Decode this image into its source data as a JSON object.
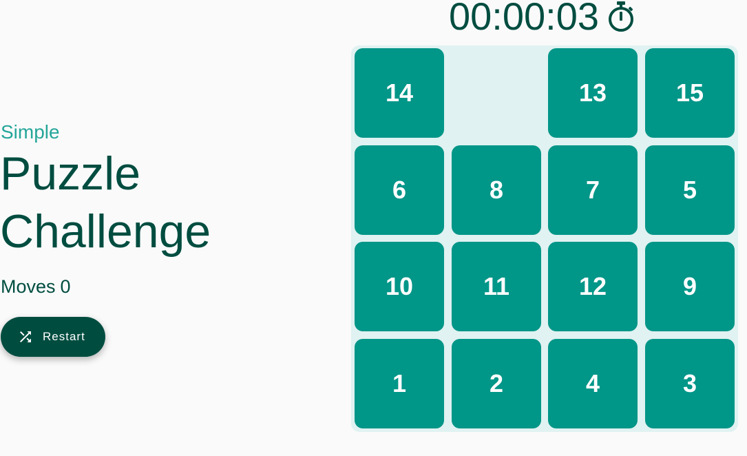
{
  "header": {
    "subtitle": "Simple",
    "title_line1": "Puzzle",
    "title_line2": "Challenge"
  },
  "moves": {
    "label": "Moves",
    "count": "0"
  },
  "restart": {
    "label": "Restart",
    "icon": "shuffle-icon"
  },
  "timer": {
    "value": "00:00:03",
    "icon": "stopwatch-icon"
  },
  "board": {
    "rows": 4,
    "cols": 4,
    "tiles": [
      "14",
      "",
      "13",
      "15",
      "6",
      "8",
      "7",
      "5",
      "10",
      "11",
      "12",
      "9",
      "1",
      "2",
      "4",
      "3"
    ]
  },
  "colors": {
    "background": "#fafafa",
    "primary_dark": "#004d40",
    "tile": "#009688",
    "board": "#e0f2f1",
    "accent": "#26a69a"
  }
}
